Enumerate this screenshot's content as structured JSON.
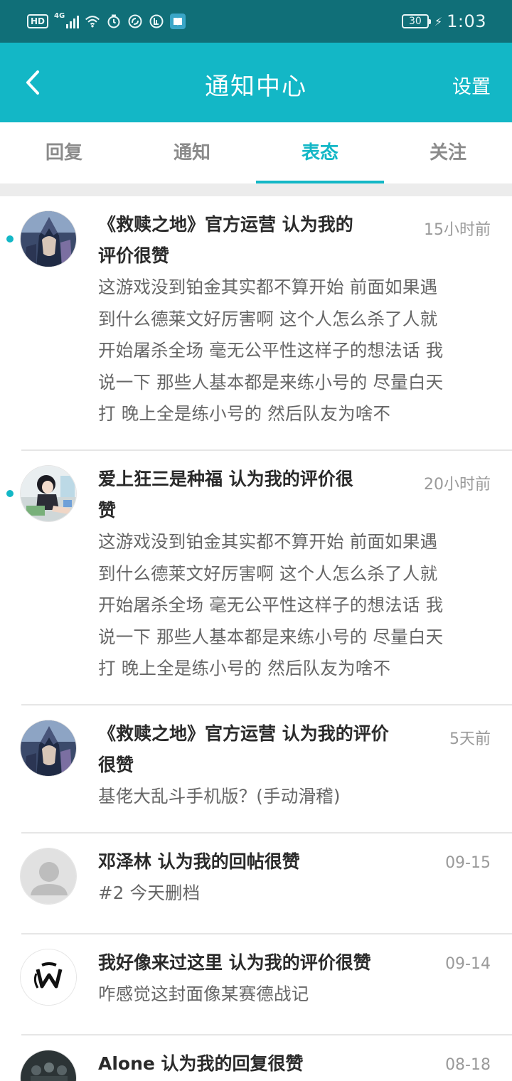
{
  "status_bar": {
    "hd": "HD",
    "network": "4G",
    "battery": "30",
    "time": "1:03",
    "icons": [
      "signal-icon",
      "wifi-icon",
      "alarm-icon",
      "netease-icon",
      "app-icon",
      "book-icon",
      "charging-icon"
    ]
  },
  "header": {
    "title": "通知中心",
    "settings": "设置",
    "back_icon": "back-arrow-icon"
  },
  "tabs": [
    {
      "label": "回复",
      "active": false
    },
    {
      "label": "通知",
      "active": false
    },
    {
      "label": "表态",
      "active": true
    },
    {
      "label": "关注",
      "active": false
    }
  ],
  "colors": {
    "status_bar": "#106f78",
    "accent": "#13b7c6",
    "title_text": "#2a2a2a",
    "body_text": "#666666",
    "time_text": "#9a9a9a"
  },
  "notifications": [
    {
      "title_line1": "《救赎之地》官方运营 认为我的",
      "title_line2": "评价很赞",
      "time": "15小时前",
      "unread": true,
      "avatar": "avatar-warrior",
      "body": [
        "这游戏没到铂金其实都不算开始 前面如果遇",
        "到什么德莱文好厉害啊 这个人怎么杀了人就",
        "开始屠杀全场 毫无公平性这样子的想法话 我",
        "说一下 那些人基本都是来练小号的 尽量白天",
        "打 晚上全是练小号的 然后队友为啥不"
      ]
    },
    {
      "title_line1": "爱上狂三是种福 认为我的评价很",
      "title_line2": "赞",
      "time": "20小时前",
      "unread": true,
      "avatar": "avatar-anime-girl",
      "body": [
        "这游戏没到铂金其实都不算开始 前面如果遇",
        "到什么德莱文好厉害啊 这个人怎么杀了人就",
        "开始屠杀全场 毫无公平性这样子的想法话 我",
        "说一下 那些人基本都是来练小号的 尽量白天",
        "打 晚上全是练小号的 然后队友为啥不"
      ]
    },
    {
      "title_line1": "《救赎之地》官方运营 认为我的评价",
      "title_line2": "很赞",
      "time": "5天前",
      "unread": false,
      "avatar": "avatar-warrior",
      "body": [
        "基佬大乱斗手机版？(手动滑稽)"
      ]
    },
    {
      "title_line1": "邓泽林 认为我的回帖很赞",
      "title_line2": "",
      "time": "09-15",
      "unread": false,
      "avatar": "avatar-default-person",
      "body": [
        "#2 今天删档"
      ]
    },
    {
      "title_line1": "我好像来过这里 认为我的评价很赞",
      "title_line2": "",
      "time": "09-14",
      "unread": false,
      "avatar": "avatar-logo",
      "body": [
        "咋感觉这封面像某赛德战记"
      ]
    },
    {
      "title_line1": "Alone 认为我的回复很赞",
      "title_line2": "",
      "time": "08-18",
      "unread": false,
      "avatar": "avatar-dark-group",
      "body": []
    }
  ]
}
